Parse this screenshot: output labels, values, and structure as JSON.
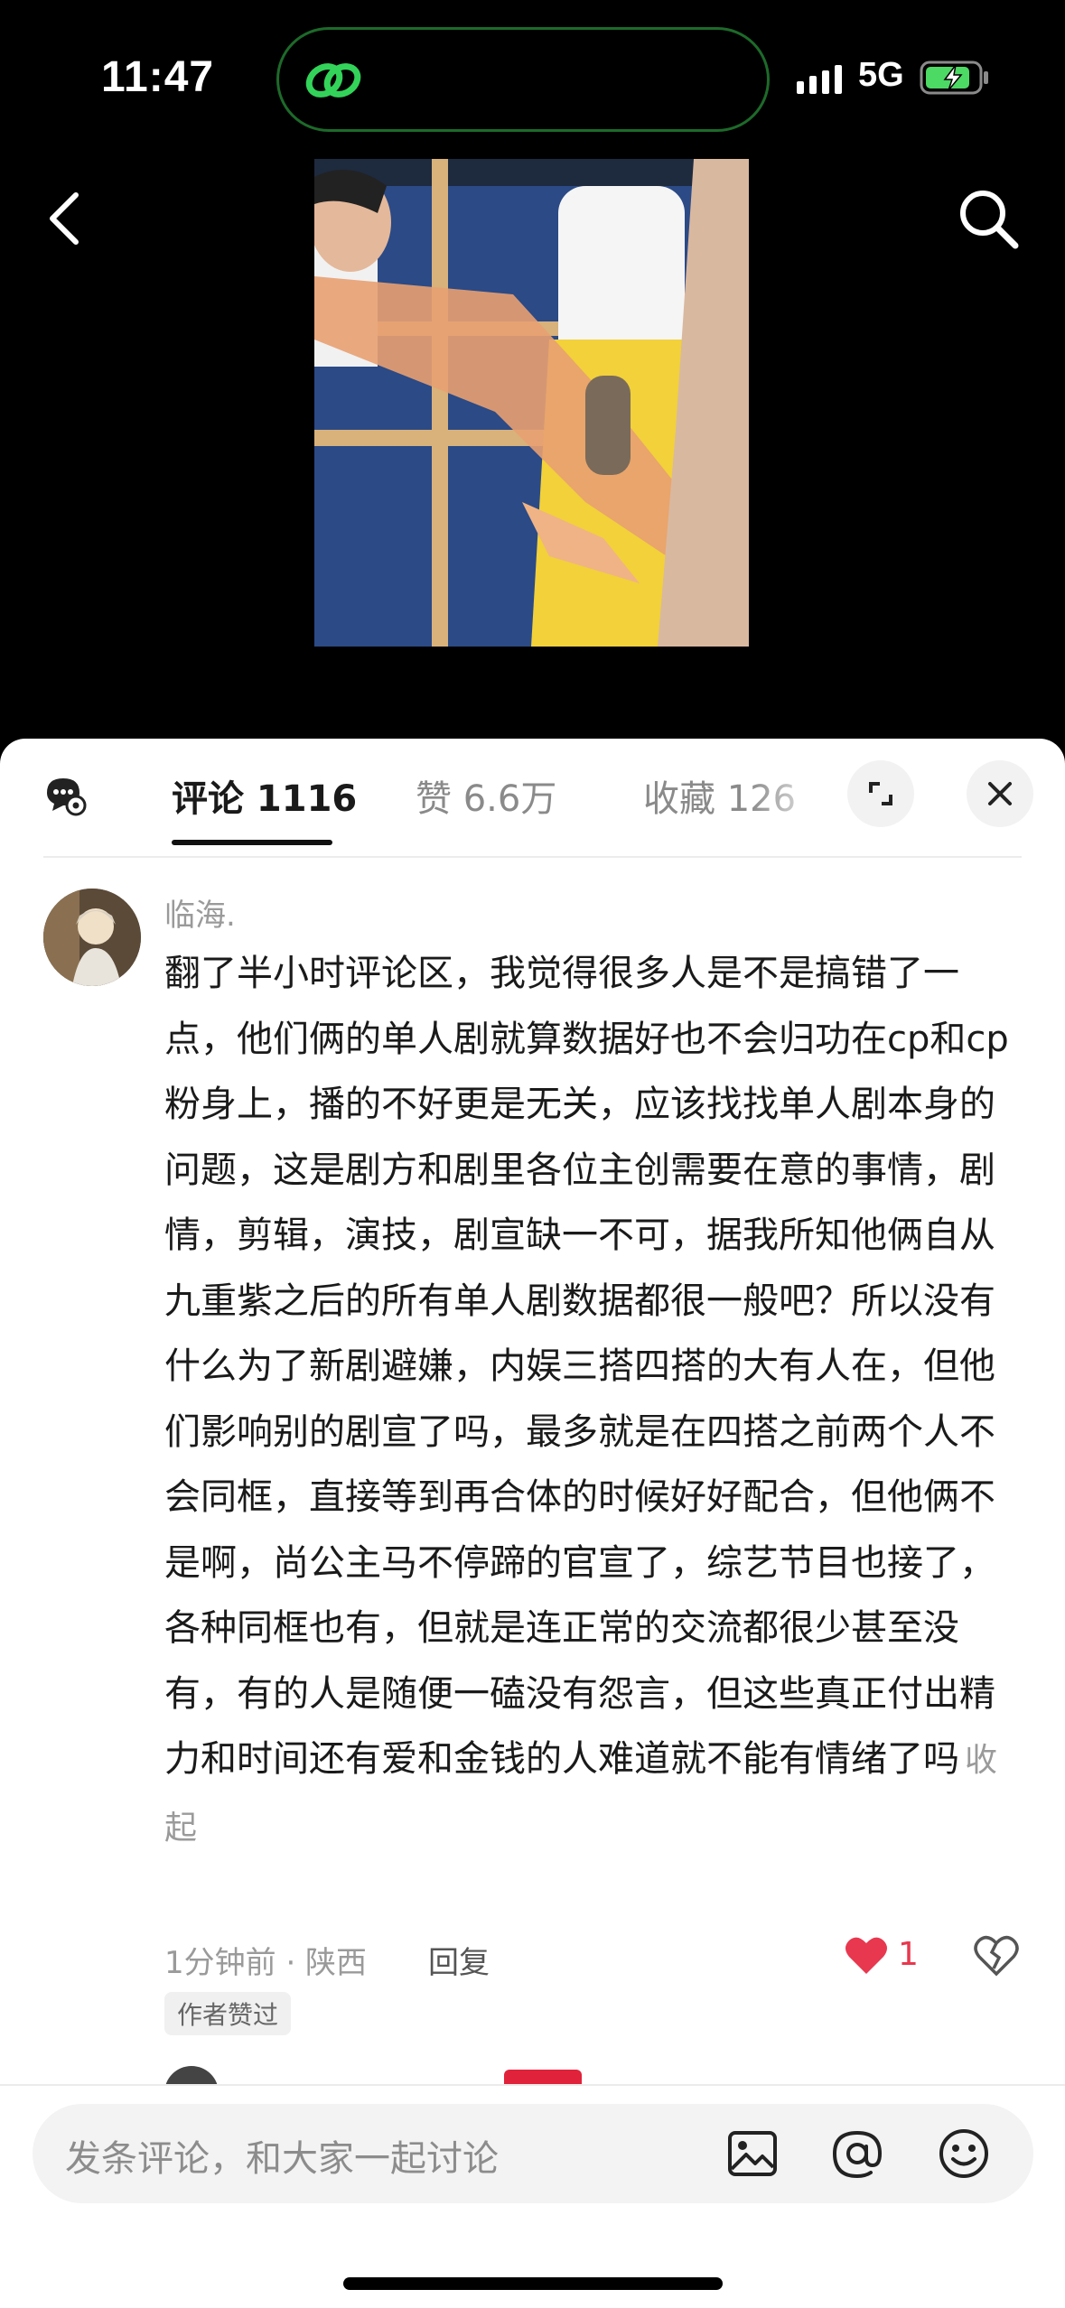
{
  "status": {
    "time": "11:47",
    "network": "5G"
  },
  "tabs": {
    "comments": "评论 1116",
    "likes": "赞 6.6万",
    "favorites": "收藏 126"
  },
  "comment": {
    "username": "临海.",
    "text": "翻了半小时评论区，我觉得很多人是不是搞错了一点，他们俩的单人剧就算数据好也不会归功在cp和cp粉身上，播的不好更是无关，应该找找单人剧本身的问题，这是剧方和剧里各位主创需要在意的事情，剧情，剪辑，演技，剧宣缺一不可，据我所知他俩自从九重紫之后的所有单人剧数据都很一般吧？所以没有什么为了新剧避嫌，内娱三搭四搭的大有人在，但他们影响别的剧宣了吗，最多就是在四搭之前两个人不会同框，直接等到再合体的时候好好配合，但他俩不是啊，尚公主马不停蹄的官宣了，综艺节目也接了，各种同框也有，但就是连正常的交流都很少甚至没有，有的人是随便一磕没有怨言，但这些真正付出精力和时间还有爱和金钱的人难道就不能有情绪了吗",
    "collapse_label": "收起",
    "meta": "1分钟前 · 陕西",
    "reply_label": "回复",
    "like_count": "1",
    "author_badge": "作者赞过"
  },
  "input": {
    "placeholder": "发条评论，和大家一起讨论"
  },
  "colors": {
    "like": "#e8384f",
    "island_border": "#1d6a2a",
    "battery": "#4cd964"
  }
}
